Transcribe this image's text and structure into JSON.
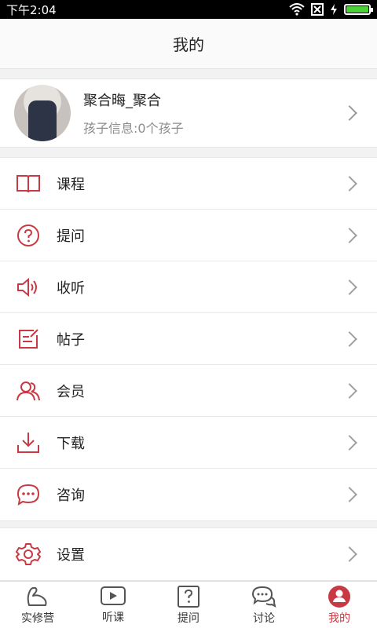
{
  "status_bar": {
    "time": "下午2:04",
    "icons": [
      "wifi-icon",
      "close-box-icon",
      "charging-icon",
      "battery-icon"
    ],
    "battery_level": 1.0
  },
  "header": {
    "title": "我的"
  },
  "profile": {
    "name": "聚合晦_聚合",
    "subtitle": "孩子信息:0个孩子"
  },
  "menu": {
    "items": [
      {
        "label": "课程",
        "icon": "book-icon"
      },
      {
        "label": "提问",
        "icon": "question-circle-icon"
      },
      {
        "label": "收听",
        "icon": "speaker-icon"
      },
      {
        "label": "帖子",
        "icon": "edit-note-icon"
      },
      {
        "label": "会员",
        "icon": "members-icon"
      },
      {
        "label": "下载",
        "icon": "download-icon"
      },
      {
        "label": "咨询",
        "icon": "chat-dots-icon"
      }
    ],
    "settings": {
      "label": "设置",
      "icon": "gear-icon"
    }
  },
  "tabbar": {
    "items": [
      {
        "label": "实修营",
        "icon": "muscle-icon"
      },
      {
        "label": "听课",
        "icon": "play-video-icon"
      },
      {
        "label": "提问",
        "icon": "question-box-icon"
      },
      {
        "label": "讨论",
        "icon": "discussion-icon"
      },
      {
        "label": "我的",
        "icon": "profile-icon",
        "active": true
      }
    ]
  },
  "colors": {
    "accent": "#c83a43",
    "battery_green": "#4cd137",
    "text_primary": "#222222",
    "text_secondary": "#8c8c8c"
  }
}
